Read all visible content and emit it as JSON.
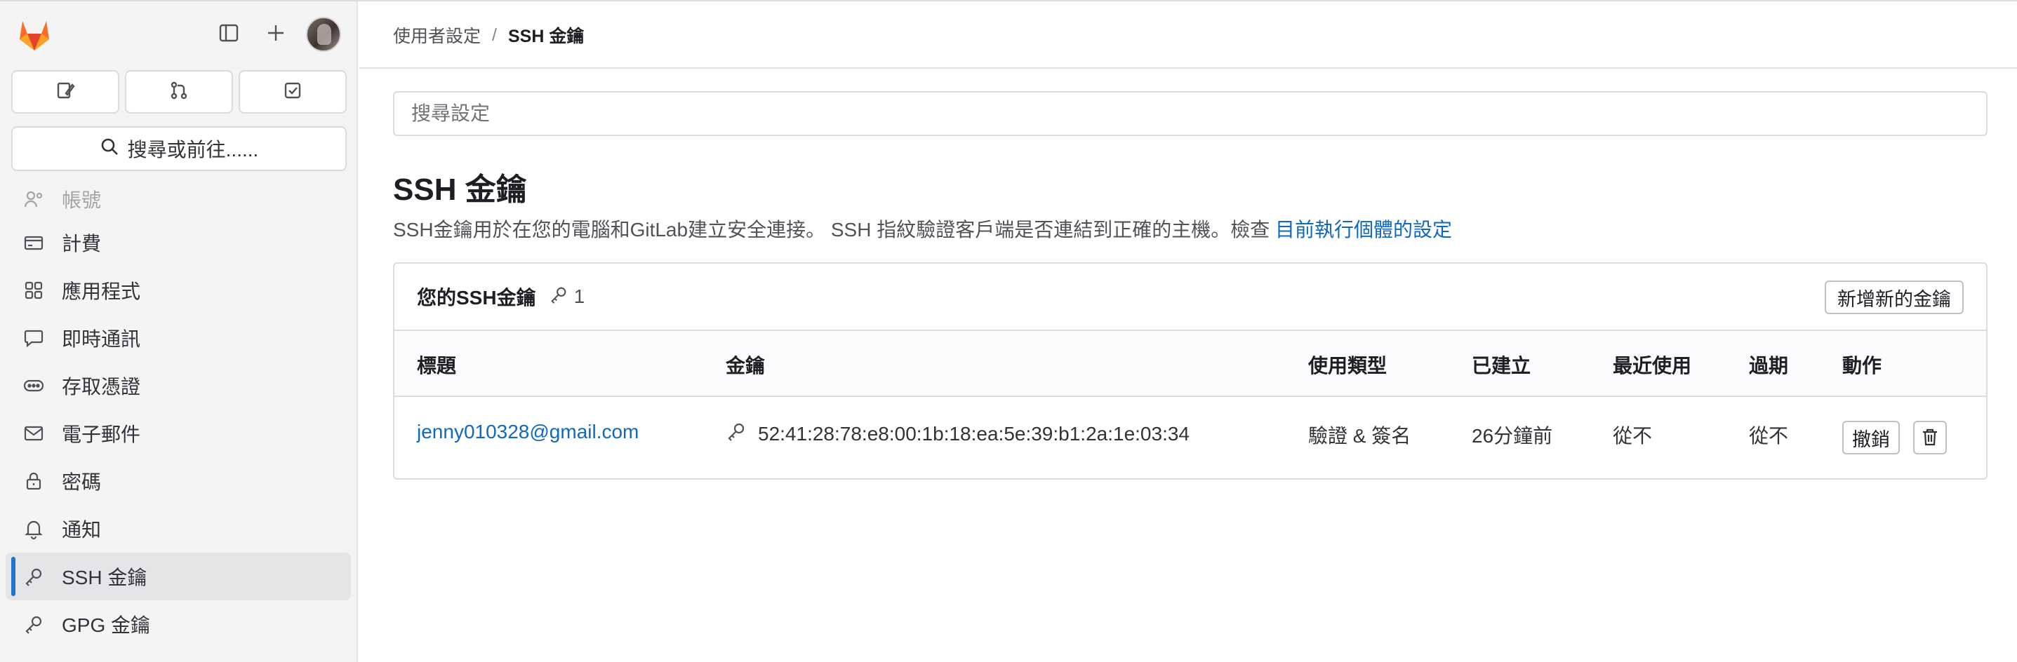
{
  "sidebar": {
    "logo": "gitlab-tanuki-logo",
    "top_icons": [
      "sidebar-toggle-icon",
      "plus-icon"
    ],
    "quick_actions": [
      "issues-icon",
      "merge-request-icon",
      "todo-icon"
    ],
    "search_label": "搜尋或前往......",
    "items": [
      {
        "label": "帳號",
        "icon": "account-icon"
      },
      {
        "label": "計費",
        "icon": "billing-icon"
      },
      {
        "label": "應用程式",
        "icon": "applications-icon"
      },
      {
        "label": "即時通訊",
        "icon": "chat-icon"
      },
      {
        "label": "存取憑證",
        "icon": "token-icon"
      },
      {
        "label": "電子郵件",
        "icon": "mail-icon"
      },
      {
        "label": "密碼",
        "icon": "lock-icon"
      },
      {
        "label": "通知",
        "icon": "bell-icon"
      },
      {
        "label": "SSH 金鑰",
        "icon": "key-icon"
      },
      {
        "label": "GPG 金鑰",
        "icon": "key-icon"
      }
    ],
    "active_index": 8
  },
  "breadcrumb": {
    "parent": "使用者設定",
    "separator": "/",
    "current": "SSH 金鑰"
  },
  "search_settings": {
    "placeholder": "搜尋設定"
  },
  "page": {
    "title": "SSH 金鑰",
    "description": "SSH金鑰用於在您的電腦和GitLab建立安全連接。 SSH 指紋驗證客戶端是否連結到正確的主機。檢查 ",
    "description_link": "目前執行個體的設定"
  },
  "card": {
    "title": "您的SSH金鑰",
    "count": "1",
    "add_button": "新增新的金鑰",
    "columns": {
      "title": "標題",
      "key": "金鑰",
      "usage": "使用類型",
      "created": "已建立",
      "last_used": "最近使用",
      "expires": "過期",
      "actions": "動作"
    },
    "rows": [
      {
        "title": "jenny010328@gmail.com",
        "fingerprint": "52:41:28:78:e8:00:1b:18:ea:5e:39:b1:2a:1e:03:34",
        "usage": "驗證 & 簽名",
        "created": "26分鐘前",
        "last_used": "從不",
        "expires": "從不",
        "revoke_label": "撤銷"
      }
    ]
  },
  "colors": {
    "accent": "#1f75cb",
    "link": "#1068bf",
    "logo_orange": "#fc6d26",
    "logo_red": "#e24329"
  }
}
